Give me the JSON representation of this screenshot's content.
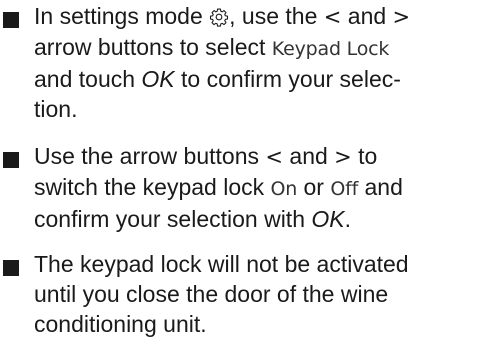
{
  "items": [
    {
      "lines": [
        {
          "a": "In settings mode ",
          "icon": "gear-icon",
          "b": ", use the ",
          "lt": "<",
          "c": " and ",
          "gt": ">"
        },
        {
          "a": "arrow buttons to select ",
          "disp": "Keypad Lock"
        },
        {
          "a": "and touch ",
          "em": "OK",
          "b": " to confirm your selec-"
        },
        {
          "a": "tion."
        }
      ]
    },
    {
      "lines": [
        {
          "a": "Use the arrow buttons ",
          "lt": "<",
          "b": " and ",
          "gt": ">",
          "c": " to"
        },
        {
          "a": "switch the keypad lock ",
          "disp1": "On",
          "b": " or ",
          "disp2": "Off",
          "c": " and"
        },
        {
          "a": "confirm your selection with ",
          "em": "OK",
          "b": "."
        }
      ]
    },
    {
      "lines": [
        {
          "a": "The keypad lock will not be activated"
        },
        {
          "a": "until you close the door of the wine"
        },
        {
          "a": "conditioning unit."
        }
      ]
    }
  ]
}
